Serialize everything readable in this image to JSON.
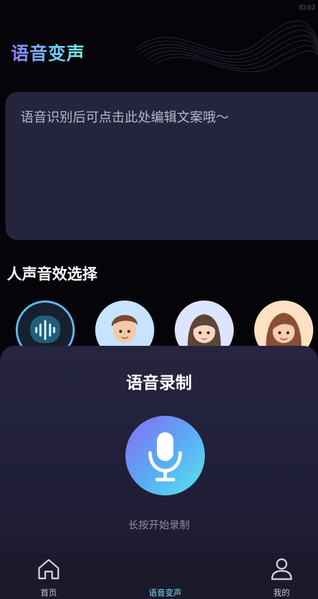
{
  "id_label": "ID:b3",
  "header": {
    "title": "语音变声"
  },
  "editor": {
    "placeholder": "语音识别后可点击此处编辑文案哦～"
  },
  "voice_effects": {
    "title": "人声音效选择",
    "items": [
      {
        "name": "voice-wave",
        "selected": true
      },
      {
        "name": "boy-avatar",
        "selected": false
      },
      {
        "name": "girl-avatar",
        "selected": false
      },
      {
        "name": "woman-avatar",
        "selected": false
      }
    ]
  },
  "record_sheet": {
    "title": "语音录制",
    "hint": "长按开始录制",
    "mic_icon": "microphone-icon"
  },
  "tabbar": {
    "items": [
      {
        "label": "首页",
        "icon": "home-icon",
        "active": false
      },
      {
        "label": "语音变声",
        "icon": "voice-wave-icon",
        "active": true
      },
      {
        "label": "我的",
        "icon": "user-icon",
        "active": false
      }
    ]
  },
  "colors": {
    "accent_start": "#8a6cf6",
    "accent_end": "#58e6e8",
    "panel": "#25243f",
    "background": "#050509"
  }
}
